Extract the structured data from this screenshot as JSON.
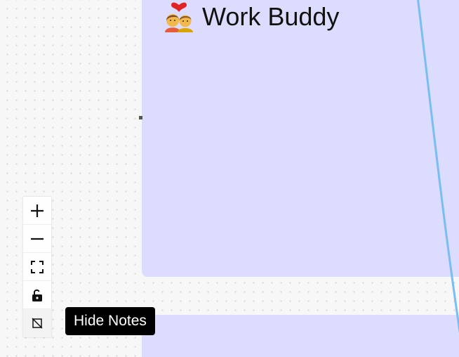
{
  "node": {
    "emoji": "couple-with-heart",
    "title": "Work Buddy"
  },
  "controls": [
    {
      "name": "zoom-in-button",
      "icon": "plus-icon"
    },
    {
      "name": "zoom-out-button",
      "icon": "minus-icon"
    },
    {
      "name": "fit-view-button",
      "icon": "fullscreen-icon"
    },
    {
      "name": "lock-button",
      "icon": "unlock-icon"
    },
    {
      "name": "hide-notes-button",
      "icon": "notes-off-icon"
    }
  ],
  "tooltip": {
    "text": "Hide Notes"
  },
  "colors": {
    "canvas_bg": "#f7f7f7",
    "group_bg": "#dcdcff",
    "edge": "#79bdf2",
    "tooltip_bg": "#000000"
  }
}
